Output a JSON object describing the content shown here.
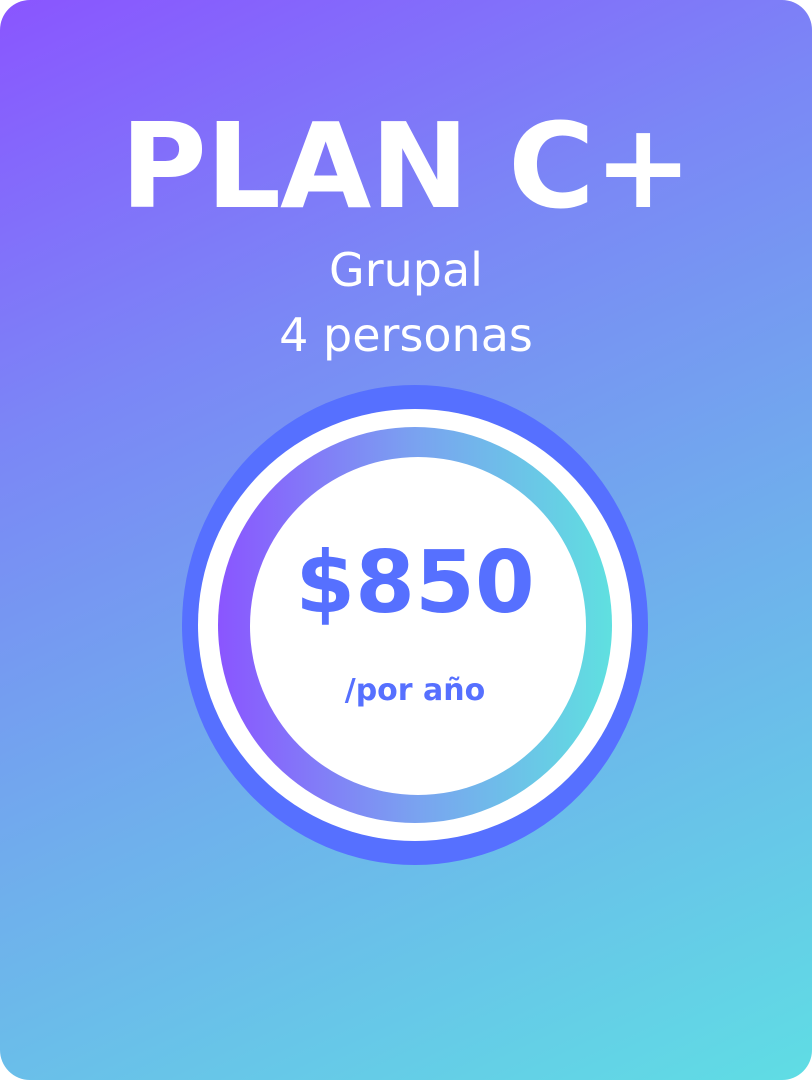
{
  "plan": {
    "title": "PLAN C+",
    "type": "Grupal",
    "people": "4 personas"
  },
  "pricing": {
    "price": "$850",
    "period": "/por año"
  },
  "colors": {
    "gradient_start": "#8a55ff",
    "gradient_end": "#5fdde4",
    "accent": "#5670ff",
    "text_light": "#ffffff"
  }
}
